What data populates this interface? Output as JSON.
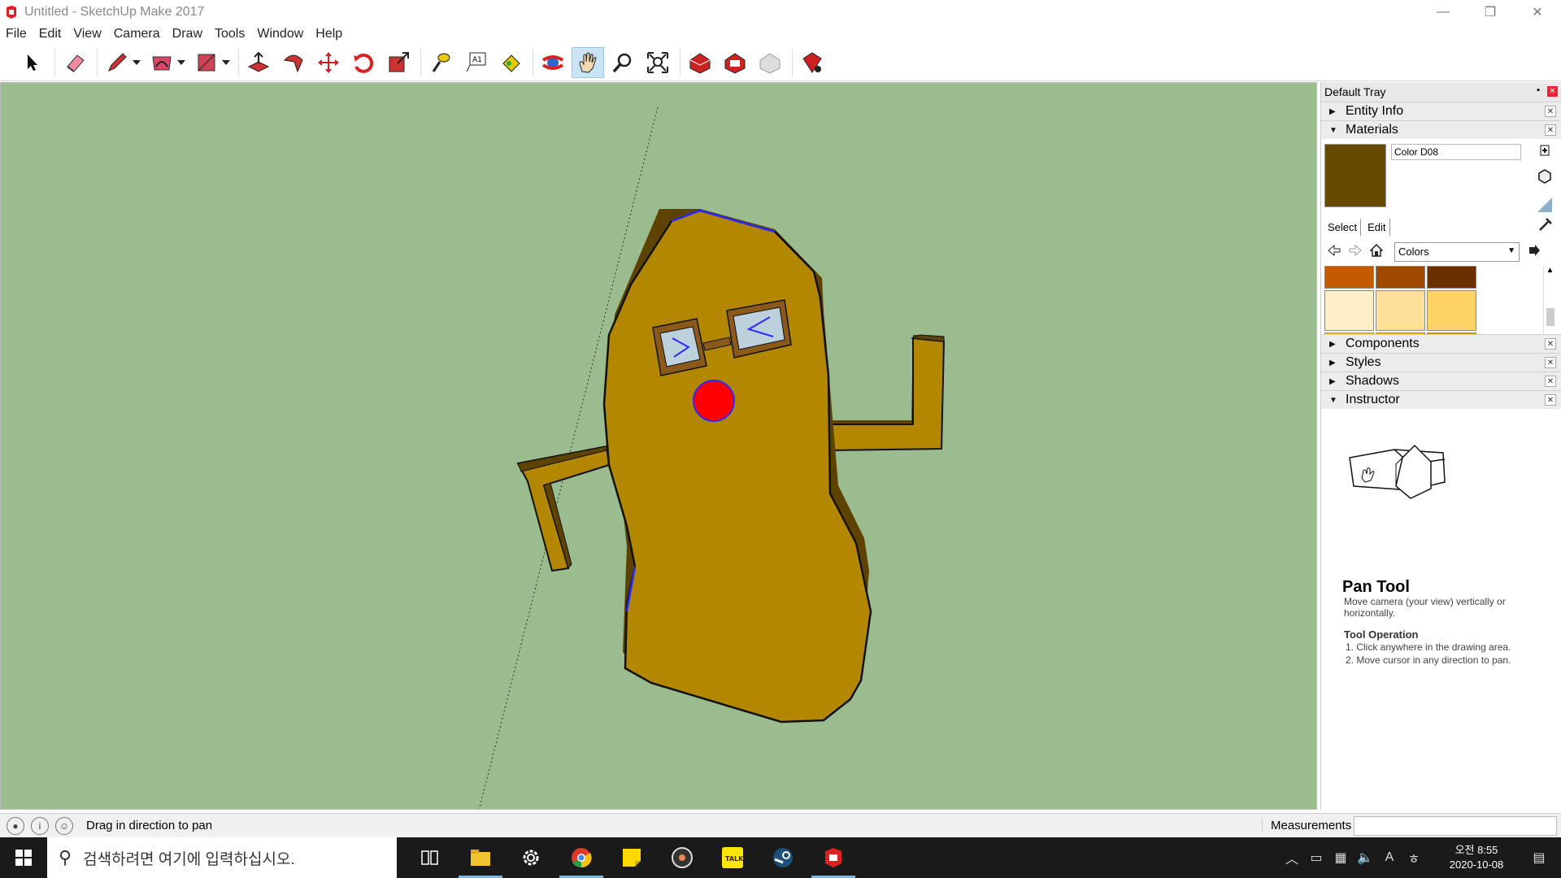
{
  "window": {
    "title": "Untitled - SketchUp Make 2017",
    "minimize": "—",
    "restore": "❐",
    "close": "✕"
  },
  "menu": [
    "File",
    "Edit",
    "View",
    "Camera",
    "Draw",
    "Tools",
    "Window",
    "Help"
  ],
  "tray": {
    "title": "Default Tray",
    "panels": {
      "entity_info": "Entity Info",
      "materials": "Materials",
      "components": "Components",
      "styles": "Styles",
      "shadows": "Shadows",
      "instructor": "Instructor"
    },
    "materials": {
      "current_name": "Color D08",
      "current_color": "#654a00",
      "tab_select": "Select",
      "tab_edit": "Edit",
      "library": "Colors",
      "swatches": [
        [
          "#c55a00",
          "#a04800",
          "#6a3000"
        ],
        [
          "#ffeec8",
          "#ffe09a",
          "#ffd366"
        ],
        [
          "#ffcc33",
          "#ffbb00",
          "#d19a00"
        ],
        [
          "#9a7200",
          "#654a00",
          "#ffffcc"
        ],
        [
          "#ffff99",
          "#ffff66",
          "#ffff33"
        ]
      ]
    },
    "instructor": {
      "tool_name": "Pan Tool",
      "description": "Move camera (your view) vertically or horizontally.",
      "operation_title": "Tool Operation",
      "steps": [
        "1. Click anywhere in the drawing area.",
        "2. Move cursor in any direction to pan."
      ]
    }
  },
  "status": {
    "message": "Drag in direction to pan",
    "measurements_label": "Measurements",
    "measurements_value": ""
  },
  "taskbar": {
    "search_placeholder": "검색하려면 여기에 입력하십시오.",
    "time": "오전 8:55",
    "date": "2020-10-08",
    "lang": "A"
  },
  "colors": {
    "viewport_bg": "#9bbc8e",
    "figure_face": "#b48700",
    "figure_side": "#5e4300",
    "nose": "#ff0000",
    "glasses_frame": "#8b5a1a",
    "glasses_lens": "#bcd1dc"
  }
}
